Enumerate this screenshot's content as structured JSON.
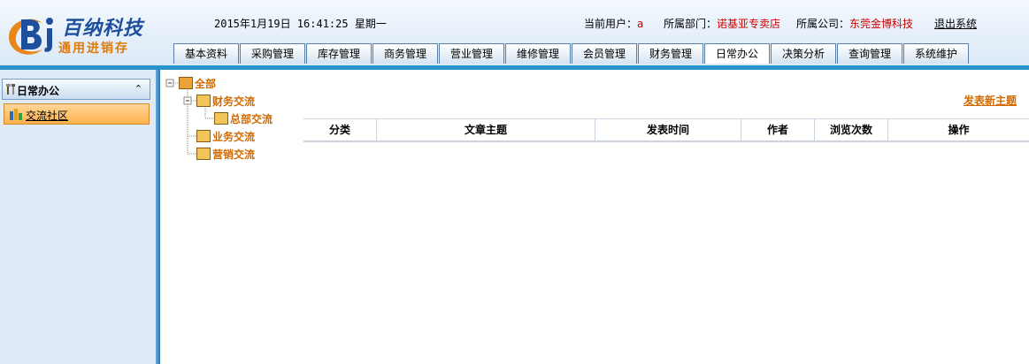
{
  "header": {
    "logo_title": "百纳科技",
    "logo_subtitle": "通用进销存",
    "datetime": "2015年1月19日 16:41:25 星期一",
    "user_label": "当前用户：",
    "user_value": "a",
    "dept_label": "所属部门：",
    "dept_value": "诺基亚专卖店",
    "company_label": "所属公司：",
    "company_value": "东莞金博科技",
    "logout": "退出系统"
  },
  "tabs": [
    {
      "label": "基本资料"
    },
    {
      "label": "采购管理"
    },
    {
      "label": "库存管理"
    },
    {
      "label": "商务管理"
    },
    {
      "label": "营业管理"
    },
    {
      "label": "维修管理"
    },
    {
      "label": "会员管理"
    },
    {
      "label": "财务管理"
    },
    {
      "label": "日常办公"
    },
    {
      "label": "决策分析"
    },
    {
      "label": "查询管理"
    },
    {
      "label": "系统维护"
    }
  ],
  "active_tab": "日常办公",
  "sidebar": {
    "section_title": "日常办公",
    "items": [
      {
        "label": "交流社区"
      }
    ]
  },
  "tree": {
    "root": "全部",
    "nodes": [
      {
        "label": "财务交流",
        "children": [
          {
            "label": "总部交流"
          }
        ]
      },
      {
        "label": "业务交流"
      },
      {
        "label": "营销交流"
      }
    ]
  },
  "main": {
    "new_topic": "发表新主题",
    "columns": [
      "分类",
      "文章主题",
      "发表时间",
      "作者",
      "浏览次数",
      "操作"
    ]
  },
  "colors": {
    "accent_blue": "#2a93cc",
    "tree_orange": "#d06a00",
    "value_red": "#cc0000"
  }
}
